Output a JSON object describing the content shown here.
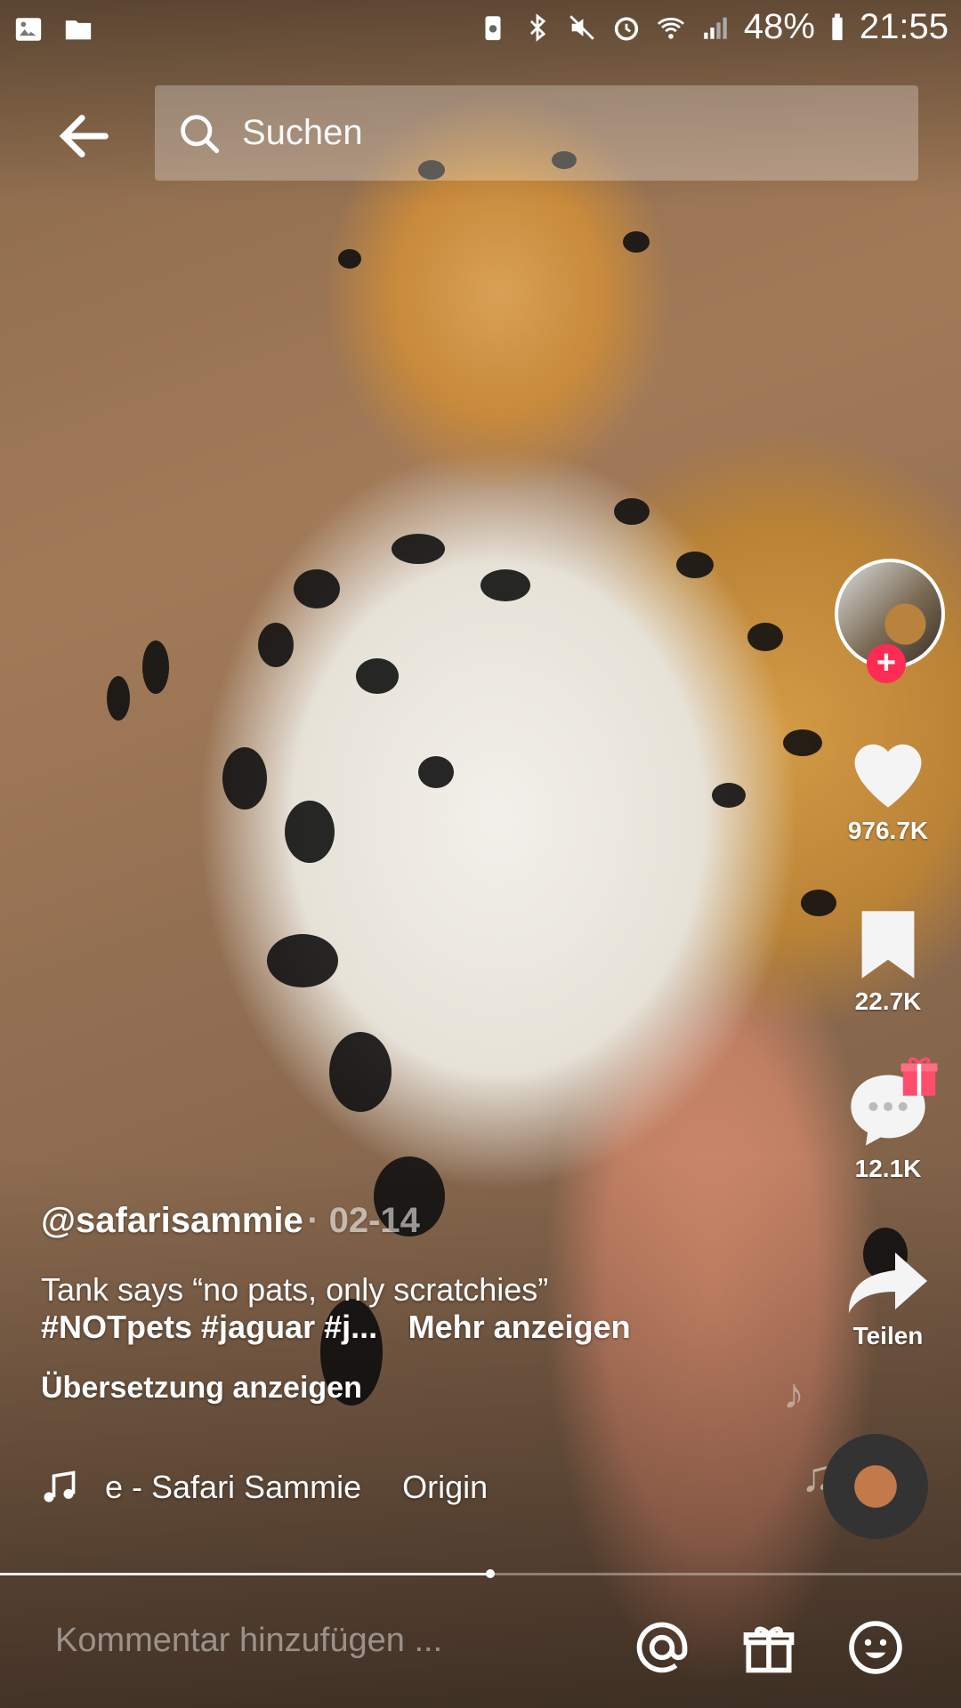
{
  "status_bar": {
    "battery_percent": "48%",
    "time": "21:55",
    "left_icons": [
      "image-icon",
      "folder-icon"
    ],
    "right_icons": [
      "battery-saver-icon",
      "bluetooth-icon",
      "mute-icon",
      "alarm-icon",
      "wifi-icon",
      "signal-icon",
      "battery-icon"
    ]
  },
  "search": {
    "placeholder": "Suchen"
  },
  "side_actions": {
    "likes": "976.7K",
    "bookmarks": "22.7K",
    "comments": "12.1K",
    "share_label": "Teilen"
  },
  "post": {
    "username": "@safarisammie",
    "date": "· 02-14",
    "description": "Tank says “no pats, only scratchies” ",
    "hashtags": "#NOTpets #jaguar #j...",
    "more_label": "Mehr anzeigen",
    "translate_label": "Übersetzung anzeigen"
  },
  "music": {
    "track": "e - Safari Sammie",
    "origin": "Origin"
  },
  "playback": {
    "progress": 0.51
  },
  "comment_bar": {
    "placeholder": "Kommentar hinzufügen ..."
  },
  "colors": {
    "follow_accent": "#fe2c55",
    "gift_accent": "#ff4d6d"
  }
}
